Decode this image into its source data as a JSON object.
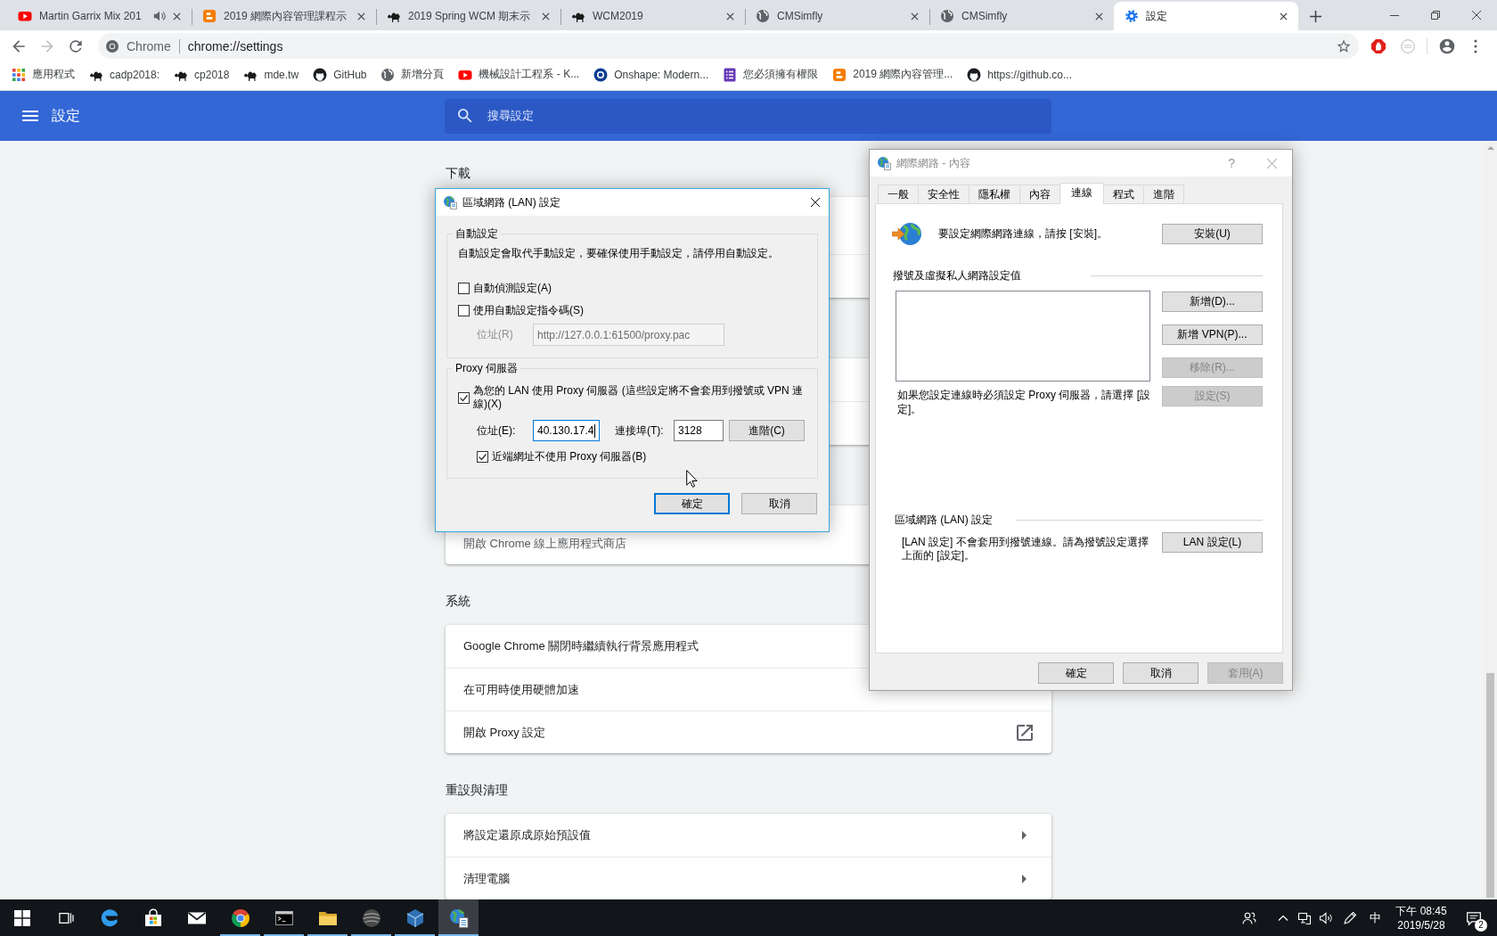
{
  "browser": {
    "tabs": [
      {
        "title": "Martin Garrix Mix 201",
        "audio": true,
        "selected": false
      },
      {
        "title": "2019 網際內容管理課程示",
        "audio": false,
        "selected": false
      },
      {
        "title": "2019 Spring WCM 期末示",
        "audio": false,
        "selected": false
      },
      {
        "title": "WCM2019",
        "audio": false,
        "selected": false
      },
      {
        "title": "CMSimfly",
        "audio": false,
        "selected": false
      },
      {
        "title": "CMSimfly",
        "audio": false,
        "selected": false
      },
      {
        "title": "設定",
        "audio": false,
        "selected": true
      }
    ],
    "navigation": {
      "back_disabled": false,
      "forward_disabled": true
    },
    "omnibox": {
      "site_label": "Chrome",
      "url": "chrome://settings"
    },
    "bookmarks": [
      {
        "label": "應用程式"
      },
      {
        "label": "cadp2018:"
      },
      {
        "label": "cp2018"
      },
      {
        "label": "mde.tw"
      },
      {
        "label": "GitHub"
      },
      {
        "label": "新增分頁"
      },
      {
        "label": "機械設計工程系 - K..."
      },
      {
        "label": "Onshape: Modern..."
      },
      {
        "label": "您必須擁有權限"
      },
      {
        "label": "2019 網際內容管理..."
      },
      {
        "label": "https://github.co..."
      }
    ]
  },
  "settings_page": {
    "title": "設定",
    "search": {
      "placeholder": "搜尋設定"
    },
    "sections": [
      {
        "heading": "下載"
      },
      {
        "rows": [
          {
            "secondary": "開啟 Chrome 線上應用程式商店"
          }
        ]
      },
      {
        "heading": "系統",
        "rows": [
          {
            "label": "Google Chrome 關閉時繼續執行背景應用程式",
            "kind": "plain"
          },
          {
            "label": "在可用時使用硬體加速",
            "kind": "plain"
          },
          {
            "label": "開啟 Proxy 設定",
            "kind": "external_link"
          }
        ]
      },
      {
        "heading": "重設與清理",
        "rows": [
          {
            "label": "將設定還原成原始預設值",
            "kind": "submenu"
          },
          {
            "label": "清理電腦",
            "kind": "submenu"
          }
        ]
      }
    ]
  },
  "lan_dialog": {
    "title": "區域網路 (LAN) 設定",
    "active": true,
    "auto_group": {
      "legend": "自動設定",
      "note": "自動設定會取代手動設定，要確保使用手動設定，請停用自動設定。",
      "options": [
        {
          "label": "自動偵測設定(A)",
          "checked": false
        },
        {
          "label": "使用自動設定指令碼(S)",
          "checked": false
        }
      ],
      "script_address": {
        "label": "位址(R)",
        "value": "http://127.0.0.1:61500/proxy.pac",
        "disabled": true
      }
    },
    "proxy_group": {
      "legend": "Proxy 伺服器",
      "use_proxy": {
        "label": "為您的 LAN 使用 Proxy 伺服器 (這些設定將不會套用到撥號或 VPN 連線)(X)",
        "checked": true
      },
      "address": {
        "label": "位址(E):",
        "value": "40.130.17.4",
        "focused": true
      },
      "port": {
        "label": "連接埠(T):",
        "value": "3128",
        "focused": false
      },
      "advanced_button": "進階(C)",
      "bypass_local": {
        "label": "近端網址不使用 Proxy 伺服器(B)",
        "checked": true
      }
    },
    "buttons": [
      {
        "label": "確定",
        "default": true
      },
      {
        "label": "取消",
        "default": false
      }
    ]
  },
  "internet_options": {
    "title": "網際網路 - 內容",
    "active": false,
    "help_button": "?",
    "tabs": [
      {
        "label": "一般",
        "selected": false
      },
      {
        "label": "安全性",
        "selected": false
      },
      {
        "label": "隱私權",
        "selected": false
      },
      {
        "label": "內容",
        "selected": false
      },
      {
        "label": "連線",
        "selected": true
      },
      {
        "label": "程式",
        "selected": false
      },
      {
        "label": "進階",
        "selected": false
      }
    ],
    "setup": {
      "text": "要設定網際網路連線，請按 [安裝]。",
      "button": "安裝(U)"
    },
    "dialup": {
      "heading": "撥號及虛擬私人網路設定值",
      "buttons": [
        {
          "label": "新增(D)...",
          "disabled": false
        },
        {
          "label": "新增 VPN(P)...",
          "disabled": false
        },
        {
          "label": "移除(R)...",
          "disabled": true
        },
        {
          "label": "設定(S)",
          "disabled": true
        }
      ],
      "hint": "如果您設定連線時必須設定 Proxy 伺服器，請選擇 [設定]。"
    },
    "lan": {
      "heading": "區域網路 (LAN) 設定",
      "text": "[LAN 設定] 不會套用到撥號連線。請為撥號設定選擇上面的 [設定]。",
      "button": "LAN 設定(L)"
    },
    "buttons": [
      {
        "label": "確定",
        "disabled": false
      },
      {
        "label": "取消",
        "disabled": false
      },
      {
        "label": "套用(A)",
        "disabled": true
      }
    ]
  },
  "taskbar": {
    "apps": [
      {
        "running": false,
        "active": false
      },
      {
        "running": false,
        "active": false
      },
      {
        "running": false,
        "active": false
      },
      {
        "running": true,
        "active": false
      },
      {
        "running": true,
        "active": false
      },
      {
        "running": true,
        "active": false
      },
      {
        "running": true,
        "active": false
      },
      {
        "running": true,
        "active": false
      },
      {
        "running": true,
        "active": true
      }
    ],
    "ime": "中",
    "time": "下午 08:45",
    "date": "2019/5/28",
    "notification_count": "2"
  }
}
